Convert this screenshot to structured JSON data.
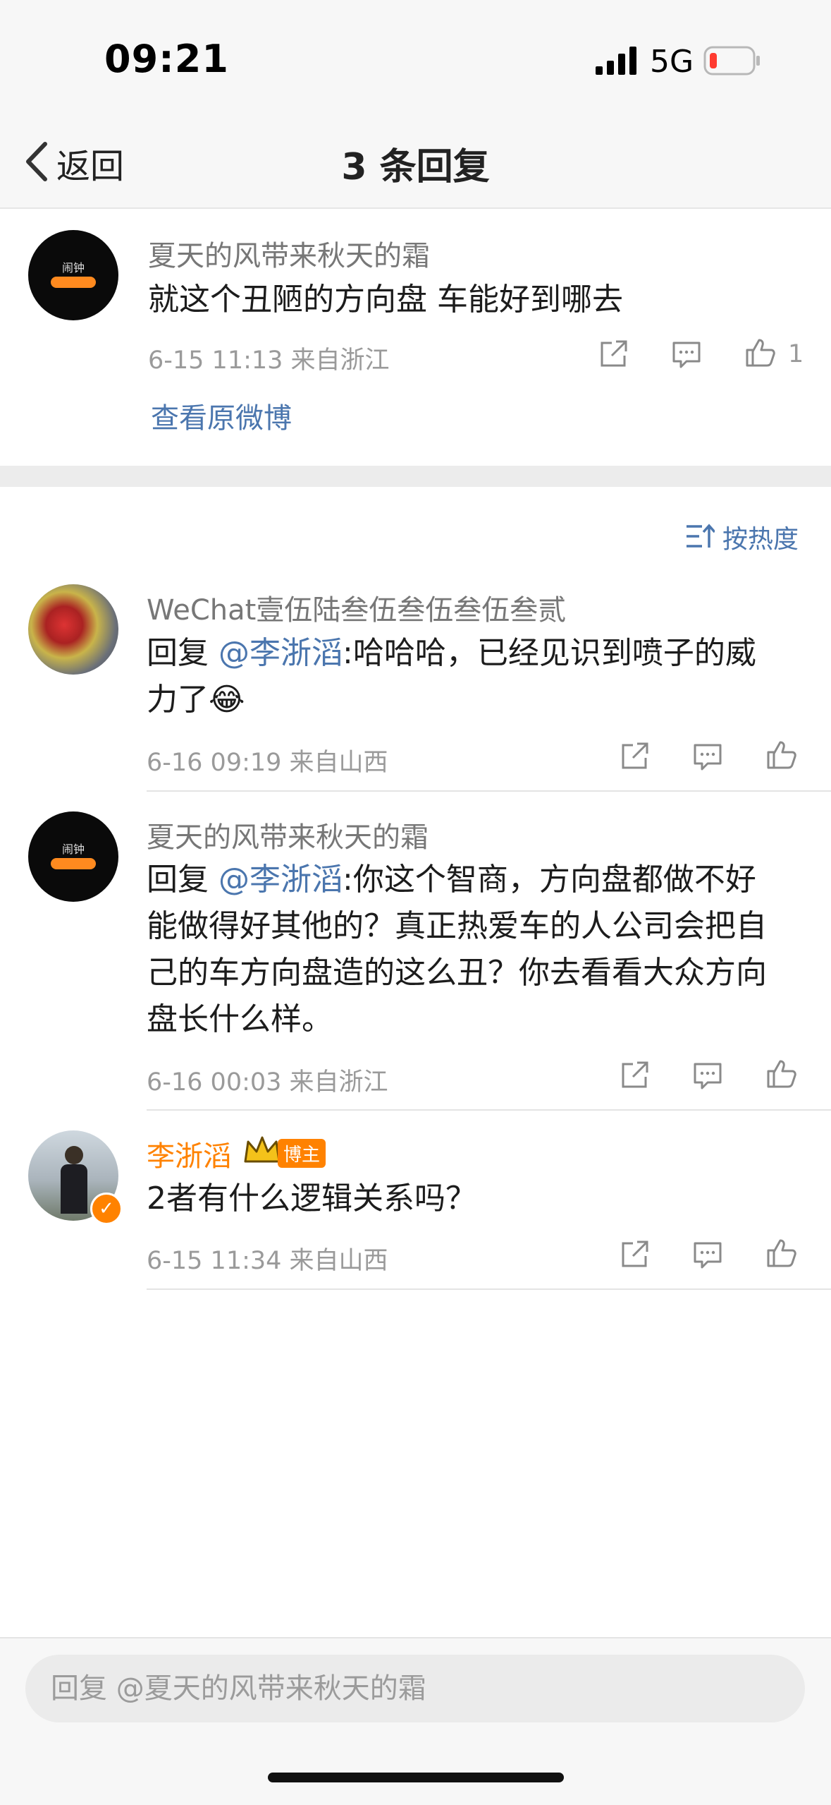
{
  "status_bar": {
    "time": "09:21",
    "network": "5G",
    "battery_low": true
  },
  "nav": {
    "back_label": "返回",
    "title": "3 条回复"
  },
  "origin_comment": {
    "username": "夏天的风带来秋天的霜",
    "text": "就这个丑陋的方向盘 车能好到哪去",
    "meta": "6-15 11:13 来自浙江",
    "like_count": "1",
    "view_original": "查看原微博",
    "avatar_text": "闹钟"
  },
  "sort_label": "按热度",
  "replies": [
    {
      "username": "WeChat壹伍陆叁伍叁伍叁伍叁贰",
      "prefix": "回复 ",
      "mention": "@李浙滔",
      "text": ":哈哈哈，已经见识到喷子的威",
      "text2": "力了",
      "emoji": "😂",
      "meta": "6-16 09:19 来自山西"
    },
    {
      "username": "夏天的风带来秋天的霜",
      "prefix": "回复 ",
      "mention": "@李浙滔",
      "line1": ":你这个智商，方向盘都做不好",
      "line2": "能做得好其他的？真正热爱车的人公司会把自",
      "line3": "己的车方向盘造的这么丑？你去看看大众方向",
      "line4": "盘长什么样。",
      "meta": "6-16 00:03 来自浙江",
      "avatar_text": "闹钟"
    },
    {
      "username": "李浙滔",
      "badge": "博主",
      "text": "2者有什么逻辑关系吗？",
      "meta": "6-15 11:34 来自山西"
    }
  ],
  "reply_input": {
    "placeholder": "回复 @夏天的风带来秋天的霜"
  },
  "colors": {
    "link": "#4b76ae",
    "accent_orange": "#ff8200",
    "meta_gray": "#9a9a9a"
  }
}
